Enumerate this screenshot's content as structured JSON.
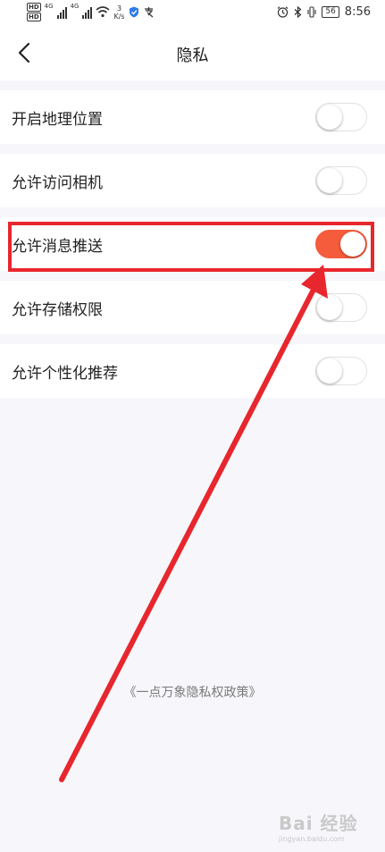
{
  "status_bar": {
    "hd1": "HD",
    "hd2": "HD",
    "net_a": "4G",
    "net_b": "4G",
    "speed_value": "3",
    "speed_unit": "K/s",
    "battery": "56",
    "time": "8:56"
  },
  "header": {
    "title": "隐私"
  },
  "settings": [
    {
      "label": "开启地理位置",
      "enabled": false
    },
    {
      "label": "允许访问相机",
      "enabled": false
    },
    {
      "label": "允许消息推送",
      "enabled": true
    },
    {
      "label": "允许存储权限",
      "enabled": false
    },
    {
      "label": "允许个性化推荐",
      "enabled": false
    }
  ],
  "policy_link": "《一点万象隐私权政策》",
  "watermark": {
    "main": "Bai 经验",
    "sub": "jingyan.baidu.com"
  },
  "colors": {
    "toggle_on": "#f55c3c",
    "annotation": "#e8262d",
    "background": "#f6f6fb"
  }
}
